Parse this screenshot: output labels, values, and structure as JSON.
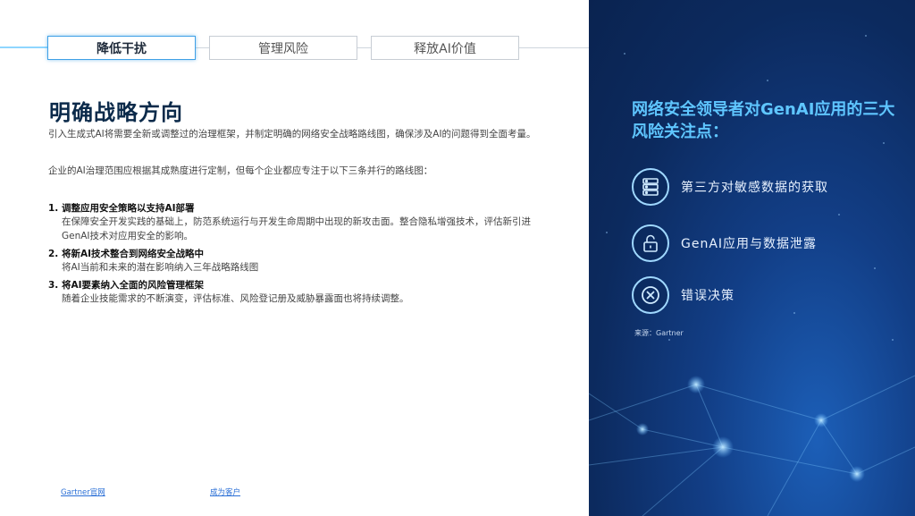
{
  "tabs": [
    {
      "label": "降低干扰"
    },
    {
      "label": "管理风险"
    },
    {
      "label": "释放AI价值"
    }
  ],
  "main": {
    "title": "明确战略方向",
    "paragraphs": [
      "引入生成式AI将需要全新或调整过的治理框架，并制定明确的网络安全战略路线图，确保涉及AI的问题得到全面考量。",
      "企业的AI治理范围应根据其成熟度进行定制，但每个企业都应专注于以下三条并行的路线图："
    ],
    "items": [
      {
        "heading": "1.  调整应用安全策略以支持AI部署",
        "body": "在保障安全开发实践的基础上，防范系统运行与开发生命周期中出现的新攻击面。整合隐私增强技术，评估新引进GenAI技术对应用安全的影响。"
      },
      {
        "heading": "2.  将新AI技术整合到网络安全战略中",
        "body": "将AI当前和未来的潜在影响纳入三年战略路线图"
      },
      {
        "heading": "3.  将AI要素纳入全面的风险管理框架",
        "body": "随着企业技能需求的不断演变，评估标准、风险登记册及威胁暴露面也将持续调整。"
      }
    ]
  },
  "footer": {
    "link1": "Gartner官网",
    "link2": "成为客户"
  },
  "panel": {
    "title": "网络安全领导者对GenAI应用的三大风险关注点：",
    "risks": [
      {
        "label": "第三方对敏感数据的获取",
        "icon": "server-icon"
      },
      {
        "label": "GenAI应用与数据泄露",
        "icon": "unlock-icon"
      },
      {
        "label": "错误决策",
        "icon": "x-circle-icon"
      }
    ],
    "source": "来源：Gartner"
  },
  "colors": {
    "accent": "#3fa0e6",
    "panel_title": "#5fc6ff",
    "panel_bg": "#0c2a5e"
  }
}
